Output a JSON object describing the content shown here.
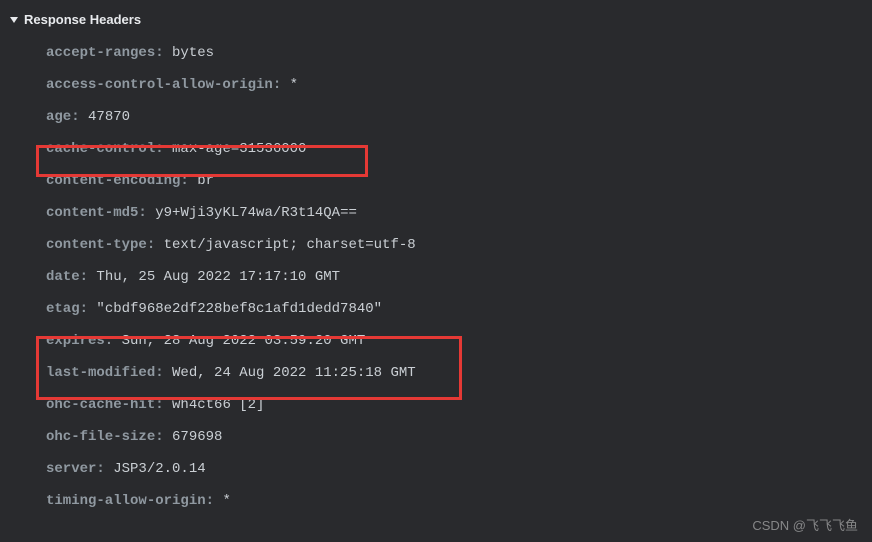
{
  "section": {
    "title": "Response Headers"
  },
  "headers": [
    {
      "name": "accept-ranges:",
      "value": "bytes"
    },
    {
      "name": "access-control-allow-origin:",
      "value": "*"
    },
    {
      "name": "age:",
      "value": "47870"
    },
    {
      "name": "cache-control:",
      "value": "max-age=31536000"
    },
    {
      "name": "content-encoding:",
      "value": "br"
    },
    {
      "name": "content-md5:",
      "value": "y9+Wji3yKL74wa/R3t14QA=="
    },
    {
      "name": "content-type:",
      "value": "text/javascript; charset=utf-8"
    },
    {
      "name": "date:",
      "value": "Thu, 25 Aug 2022 17:17:10 GMT"
    },
    {
      "name": "etag:",
      "value": "\"cbdf968e2df228bef8c1afd1dedd7840\""
    },
    {
      "name": "expires:",
      "value": "Sun, 28 Aug 2022 03:59:20 GMT"
    },
    {
      "name": "last-modified:",
      "value": "Wed, 24 Aug 2022 11:25:18 GMT"
    },
    {
      "name": "ohc-cache-hit:",
      "value": "wh4ct66 [2]"
    },
    {
      "name": "ohc-file-size:",
      "value": "679698"
    },
    {
      "name": "server:",
      "value": "JSP3/2.0.14"
    },
    {
      "name": "timing-allow-origin:",
      "value": "*"
    }
  ],
  "watermark": "CSDN @飞飞飞鱼"
}
